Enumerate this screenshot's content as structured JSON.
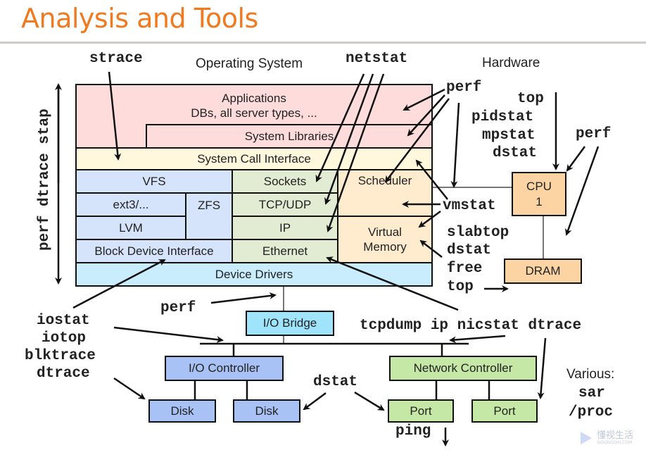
{
  "title": "Analysis and Tools",
  "section_labels": {
    "operating_system": "Operating System",
    "hardware": "Hardware"
  },
  "layers": {
    "applications_line1": "Applications",
    "applications_line2": "DBs, all server types, ...",
    "system_libraries": "System Libraries",
    "system_call_interface": "System Call Interface",
    "vfs": "VFS",
    "ext3": "ext3/...",
    "zfs": "ZFS",
    "lvm": "LVM",
    "block_device_interface": "Block Device Interface",
    "sockets": "Sockets",
    "tcp_udp": "TCP/UDP",
    "ip": "IP",
    "ethernet": "Ethernet",
    "scheduler": "Scheduler",
    "virtual_memory_line1": "Virtual",
    "virtual_memory_line2": "Memory",
    "device_drivers": "Device Drivers"
  },
  "hardware": {
    "cpu_line1": "CPU",
    "cpu_line2": "1",
    "dram": "DRAM",
    "io_bridge": "I/O Bridge",
    "io_controller": "I/O Controller",
    "disk1": "Disk",
    "disk2": "Disk",
    "network_controller": "Network Controller",
    "port1": "Port",
    "port2": "Port"
  },
  "tools": {
    "strace": "strace",
    "netstat": "netstat",
    "perf_top": "perf",
    "perf_dtrace_stap": "perf dtrace stap",
    "top": "top",
    "pidstat": "pidstat",
    "mpstat": "mpstat",
    "dstat_cpu": "dstat",
    "perf_hw": "perf",
    "vmstat": "vmstat",
    "slabtop": "slabtop",
    "dstat_mem": "dstat",
    "free": "free",
    "top_mem": "top",
    "perf_io": "perf",
    "iostat": "iostat",
    "iotop": "iotop",
    "blktrace": "blktrace",
    "dtrace_io": "dtrace",
    "tcpdump_line": "tcpdump ip nicstat dtrace",
    "dstat_dev": "dstat",
    "ping": "ping",
    "various_label": "Various:",
    "sar": "sar",
    "proc": "/proc"
  },
  "watermark": {
    "text": "懂视生活",
    "sub": "SIDONGSHI.COM"
  }
}
